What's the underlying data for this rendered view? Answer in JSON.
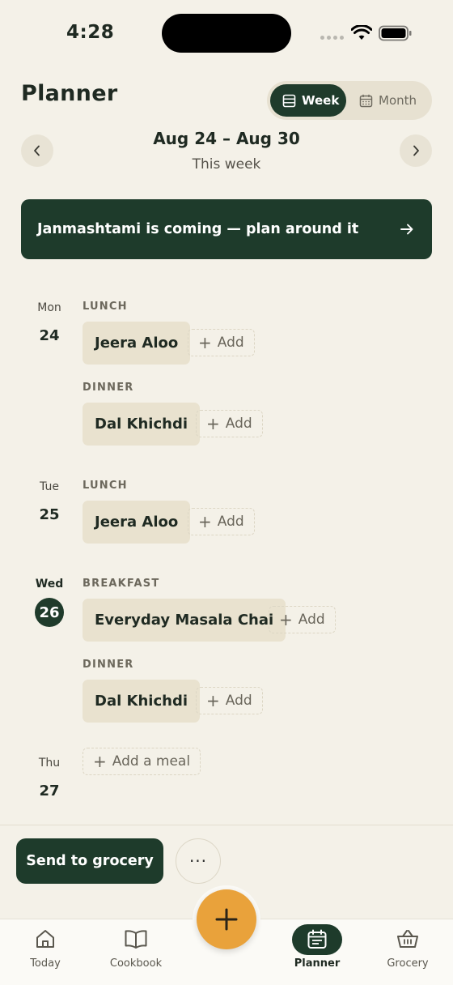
{
  "status": {
    "time": "4:28"
  },
  "header": {
    "title": "Planner",
    "view_toggle": {
      "week_label": "Week",
      "month_label": "Month",
      "selected": "Week"
    }
  },
  "range": {
    "title": "Aug 24 – Aug 30",
    "subtitle": "This week"
  },
  "banner": {
    "text": "Janmashtami is coming — plan around it"
  },
  "add_label": "Add",
  "days": [
    {
      "name": "Mon",
      "num": "24",
      "today": false,
      "meals": [
        {
          "label": "LUNCH",
          "dish": "Jeera Aloo"
        },
        {
          "label": "DINNER",
          "dish": "Dal Khichdi"
        }
      ]
    },
    {
      "name": "Tue",
      "num": "25",
      "today": false,
      "meals": [
        {
          "label": "LUNCH",
          "dish": "Jeera Aloo"
        }
      ]
    },
    {
      "name": "Wed",
      "num": "26",
      "today": true,
      "meals": [
        {
          "label": "BREAKFAST",
          "dish": "Everyday Masala Chai"
        },
        {
          "label": "DINNER",
          "dish": "Dal Khichdi"
        }
      ]
    },
    {
      "name": "Thu",
      "num": "27",
      "today": false,
      "meals": [],
      "add_meal_label": "Add a meal"
    }
  ],
  "actions": {
    "send_label": "Send to grocery",
    "more_label": "···"
  },
  "tabs": [
    {
      "label": "Today",
      "icon": "home-icon"
    },
    {
      "label": "Cookbook",
      "icon": "book-icon"
    },
    {
      "label": "Planner",
      "icon": "calendar-icon",
      "active": true
    },
    {
      "label": "Grocery",
      "icon": "basket-icon"
    }
  ],
  "colors": {
    "primary": "#1e3b2b",
    "accent": "#e9a23b",
    "background": "#f4f1e8",
    "chip": "#e9e2cf"
  }
}
